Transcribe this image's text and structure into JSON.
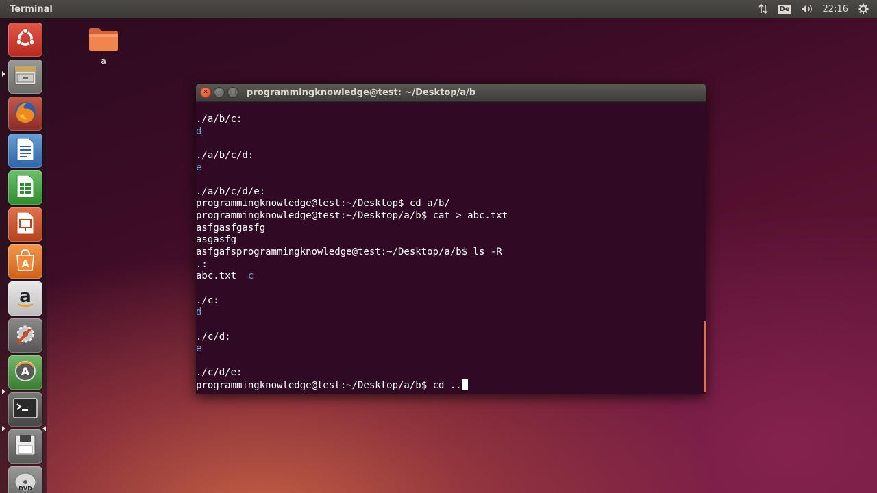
{
  "top_panel": {
    "app_title": "Terminal",
    "network_icon": "network-updown-icon",
    "keyboard_layout": "De",
    "volume_icon": "volume-icon",
    "clock": "22:16",
    "settings_icon": "gear-icon"
  },
  "launcher": {
    "items": [
      {
        "name": "dash-home",
        "icon": "ubuntu-logo-icon"
      },
      {
        "name": "files",
        "icon": "file-cabinet-icon"
      },
      {
        "name": "firefox",
        "icon": "firefox-icon"
      },
      {
        "name": "libreoffice-writer",
        "icon": "writer-icon"
      },
      {
        "name": "libreoffice-calc",
        "icon": "calc-icon"
      },
      {
        "name": "libreoffice-impress",
        "icon": "impress-icon"
      },
      {
        "name": "software-center",
        "icon": "shopping-bag-icon"
      },
      {
        "name": "amazon",
        "icon": "amazon-icon"
      },
      {
        "name": "system-settings",
        "icon": "settings-wrench-icon"
      },
      {
        "name": "software-updater",
        "icon": "updater-icon"
      },
      {
        "name": "terminal",
        "icon": "terminal-icon"
      },
      {
        "name": "floppy",
        "icon": "floppy-icon"
      },
      {
        "name": "dvd",
        "icon": "dvd-icon",
        "label": "DVD"
      }
    ]
  },
  "desktop": {
    "folder_label": "a"
  },
  "terminal": {
    "title": "programmingknowledge@test: ~/Desktop/a/b",
    "lines": [
      {
        "text": "./a/b/c:",
        "color": "white"
      },
      {
        "text": "d",
        "color": "blue"
      },
      {
        "text": "",
        "color": "white"
      },
      {
        "text": "./a/b/c/d:",
        "color": "white"
      },
      {
        "text": "e",
        "color": "blue"
      },
      {
        "text": "",
        "color": "white"
      },
      {
        "text": "./a/b/c/d/e:",
        "color": "white"
      },
      {
        "text": "programmingknowledge@test:~/Desktop$ cd a/b/",
        "color": "white"
      },
      {
        "text": "programmingknowledge@test:~/Desktop/a/b$ cat > abc.txt",
        "color": "white"
      },
      {
        "text": "asfgasfgasfg",
        "color": "white"
      },
      {
        "text": "asgasfg",
        "color": "white"
      },
      {
        "text": "asfgafsprogrammingknowledge@test:~/Desktop/a/b$ ls -R",
        "color": "white"
      },
      {
        "text": ".:",
        "color": "white"
      },
      {
        "text": "abc.txt  ",
        "color": "white",
        "extra_blue": "c"
      },
      {
        "text": "",
        "color": "white"
      },
      {
        "text": "./c:",
        "color": "white"
      },
      {
        "text": "d",
        "color": "blue"
      },
      {
        "text": "",
        "color": "white"
      },
      {
        "text": "./c/d:",
        "color": "white"
      },
      {
        "text": "e",
        "color": "blue"
      },
      {
        "text": "",
        "color": "white"
      },
      {
        "text": "./c/d/e:",
        "color": "white"
      }
    ],
    "prompt_line": "programmingknowledge@test:~/Desktop/a/b$ cd ..",
    "colors": {
      "background": "#300a24",
      "directory": "#729fcf",
      "text": "#ffffff"
    }
  }
}
